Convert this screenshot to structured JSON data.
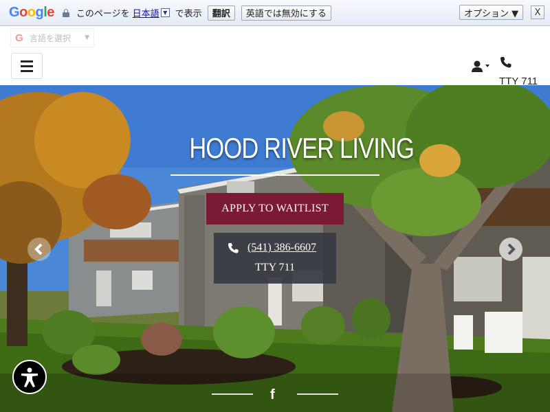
{
  "translate_bar": {
    "logo": [
      "G",
      "o",
      "o",
      "g",
      "l",
      "e"
    ],
    "logo_colors": [
      "#4285f4",
      "#ea4335",
      "#fbbc05",
      "#4285f4",
      "#34a853",
      "#ea4335"
    ],
    "prefix": "このページを",
    "language": "日本語",
    "suffix": "で表示",
    "translate_label": "翻訳",
    "never_label": "英語では無効にする",
    "options_label": "オプション ▼",
    "close_label": "X"
  },
  "language_select": {
    "label": "言語を選択",
    "caret": "▼"
  },
  "header": {
    "menu_icon": "hamburger-icon",
    "user_icon": "user-icon",
    "phone_icon": "phone-icon",
    "tty": "TTY 711"
  },
  "hero": {
    "title": "HOOD RIVER LIVING",
    "apply_label": "APPLY TO WAITLIST",
    "phone": "(541) 386-6607",
    "tty": "TTY 711",
    "brand_color": "#7a1a34",
    "social": "f"
  }
}
